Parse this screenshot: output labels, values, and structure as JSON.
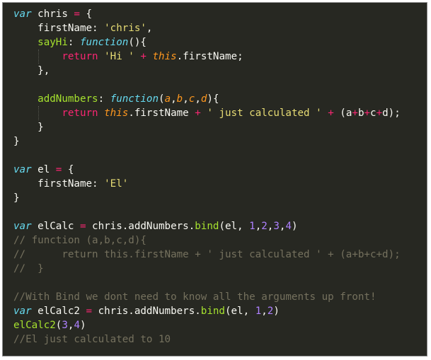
{
  "lines": [
    {
      "tokens": [
        {
          "t": "var",
          "c": "kw"
        },
        {
          "t": " chris ",
          "c": "pl"
        },
        {
          "t": "=",
          "c": "op"
        },
        {
          "t": " {",
          "c": "pl"
        }
      ]
    },
    {
      "tokens": [
        {
          "t": "    firstName: ",
          "c": "pl"
        },
        {
          "t": "'chris'",
          "c": "str"
        },
        {
          "t": ",",
          "c": "pl"
        }
      ]
    },
    {
      "tokens": [
        {
          "t": "    ",
          "c": "pl"
        },
        {
          "t": "sayHi",
          "c": "fn"
        },
        {
          "t": ": ",
          "c": "pl"
        },
        {
          "t": "function",
          "c": "kw"
        },
        {
          "t": "(){",
          "c": "pl"
        }
      ]
    },
    {
      "tokens": [
        {
          "t": "        ",
          "c": "pl"
        },
        {
          "t": "return",
          "c": "rt"
        },
        {
          "t": " ",
          "c": "pl"
        },
        {
          "t": "'Hi '",
          "c": "str"
        },
        {
          "t": " ",
          "c": "pl"
        },
        {
          "t": "+",
          "c": "op"
        },
        {
          "t": " ",
          "c": "pl"
        },
        {
          "t": "this",
          "c": "ths"
        },
        {
          "t": ".firstName;",
          "c": "pl"
        }
      ]
    },
    {
      "tokens": [
        {
          "t": "    },",
          "c": "pl"
        }
      ]
    },
    {
      "tokens": [
        {
          "t": "",
          "c": "pl"
        }
      ]
    },
    {
      "tokens": [
        {
          "t": "    ",
          "c": "pl"
        },
        {
          "t": "addNumbers",
          "c": "fn"
        },
        {
          "t": ": ",
          "c": "pl"
        },
        {
          "t": "function",
          "c": "kw"
        },
        {
          "t": "(",
          "c": "pl"
        },
        {
          "t": "a",
          "c": "par"
        },
        {
          "t": ",",
          "c": "pl"
        },
        {
          "t": "b",
          "c": "par"
        },
        {
          "t": ",",
          "c": "pl"
        },
        {
          "t": "c",
          "c": "par"
        },
        {
          "t": ",",
          "c": "pl"
        },
        {
          "t": "d",
          "c": "par"
        },
        {
          "t": "){",
          "c": "pl"
        }
      ]
    },
    {
      "tokens": [
        {
          "t": "        ",
          "c": "pl"
        },
        {
          "t": "return",
          "c": "rt"
        },
        {
          "t": " ",
          "c": "pl"
        },
        {
          "t": "this",
          "c": "ths"
        },
        {
          "t": ".firstName ",
          "c": "pl"
        },
        {
          "t": "+",
          "c": "op"
        },
        {
          "t": " ",
          "c": "pl"
        },
        {
          "t": "' just calculated '",
          "c": "str"
        },
        {
          "t": " ",
          "c": "pl"
        },
        {
          "t": "+",
          "c": "op"
        },
        {
          "t": " (a",
          "c": "pl"
        },
        {
          "t": "+",
          "c": "op"
        },
        {
          "t": "b",
          "c": "pl"
        },
        {
          "t": "+",
          "c": "op"
        },
        {
          "t": "c",
          "c": "pl"
        },
        {
          "t": "+",
          "c": "op"
        },
        {
          "t": "d);",
          "c": "pl"
        }
      ]
    },
    {
      "tokens": [
        {
          "t": "    }",
          "c": "pl"
        }
      ]
    },
    {
      "tokens": [
        {
          "t": "}",
          "c": "pl"
        }
      ]
    },
    {
      "tokens": [
        {
          "t": "",
          "c": "pl"
        }
      ]
    },
    {
      "tokens": [
        {
          "t": "var",
          "c": "kw"
        },
        {
          "t": " el ",
          "c": "pl"
        },
        {
          "t": "=",
          "c": "op"
        },
        {
          "t": " {",
          "c": "pl"
        }
      ]
    },
    {
      "tokens": [
        {
          "t": "    firstName: ",
          "c": "pl"
        },
        {
          "t": "'El'",
          "c": "str"
        }
      ]
    },
    {
      "tokens": [
        {
          "t": "}",
          "c": "pl"
        }
      ]
    },
    {
      "tokens": [
        {
          "t": "",
          "c": "pl"
        }
      ]
    },
    {
      "tokens": [
        {
          "t": "var",
          "c": "kw"
        },
        {
          "t": " elCalc ",
          "c": "pl"
        },
        {
          "t": "=",
          "c": "op"
        },
        {
          "t": " chris.addNumbers.",
          "c": "pl"
        },
        {
          "t": "bind",
          "c": "fn"
        },
        {
          "t": "(el, ",
          "c": "pl"
        },
        {
          "t": "1",
          "c": "num"
        },
        {
          "t": ",",
          "c": "pl"
        },
        {
          "t": "2",
          "c": "num"
        },
        {
          "t": ",",
          "c": "pl"
        },
        {
          "t": "3",
          "c": "num"
        },
        {
          "t": ",",
          "c": "pl"
        },
        {
          "t": "4",
          "c": "num"
        },
        {
          "t": ")",
          "c": "pl"
        }
      ]
    },
    {
      "tokens": [
        {
          "t": "// function (a,b,c,d){",
          "c": "cm"
        }
      ]
    },
    {
      "tokens": [
        {
          "t": "//      return this.firstName + ' just calculated ' + (a+b+c+d);",
          "c": "cm"
        }
      ]
    },
    {
      "tokens": [
        {
          "t": "//  }",
          "c": "cm"
        }
      ]
    },
    {
      "tokens": [
        {
          "t": "",
          "c": "pl"
        }
      ]
    },
    {
      "tokens": [
        {
          "t": "//With Bind we dont need to know all the arguments up front!",
          "c": "cm"
        }
      ]
    },
    {
      "tokens": [
        {
          "t": "var",
          "c": "kw"
        },
        {
          "t": " elCalc2 ",
          "c": "pl"
        },
        {
          "t": "=",
          "c": "op"
        },
        {
          "t": " chris.addNumbers.",
          "c": "pl"
        },
        {
          "t": "bind",
          "c": "fn"
        },
        {
          "t": "(el, ",
          "c": "pl"
        },
        {
          "t": "1",
          "c": "num"
        },
        {
          "t": ",",
          "c": "pl"
        },
        {
          "t": "2",
          "c": "num"
        },
        {
          "t": ")",
          "c": "pl"
        }
      ]
    },
    {
      "tokens": [
        {
          "t": "elCalc2",
          "c": "fn"
        },
        {
          "t": "(",
          "c": "pl"
        },
        {
          "t": "3",
          "c": "num"
        },
        {
          "t": ",",
          "c": "pl"
        },
        {
          "t": "4",
          "c": "num"
        },
        {
          "t": ")",
          "c": "pl"
        }
      ]
    },
    {
      "tokens": [
        {
          "t": "//El just calculated to 10",
          "c": "cm"
        }
      ]
    }
  ],
  "theme": {
    "background": "#272822",
    "keyword": "#66d9ef",
    "operator": "#f92672",
    "string": "#e6db74",
    "function": "#a6e22e",
    "number": "#ae81ff",
    "parameter": "#fd971f",
    "comment": "#75715e",
    "plain": "#f8f8f2"
  }
}
